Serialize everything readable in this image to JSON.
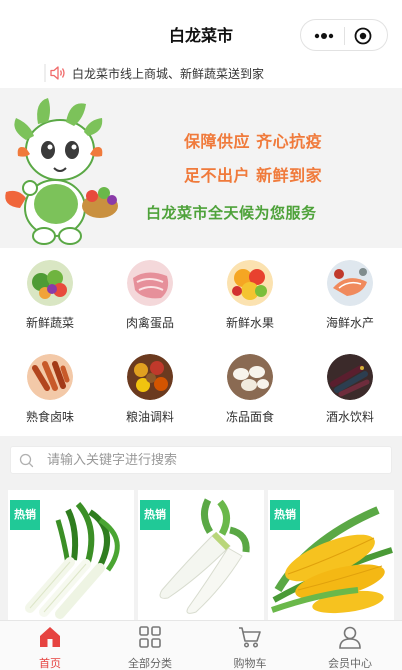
{
  "navbar": {
    "title": "白龙菜市"
  },
  "notice": {
    "text": "白龙菜市线上商城、新鲜蔬菜送到家"
  },
  "banner": {
    "line1": "保障供应 齐心抗疫",
    "line2": "足不出户 新鲜到家",
    "line3": "白龙菜市全天候为您服务",
    "colors": {
      "orange": "#f07a3b",
      "green": "#4ea23a"
    }
  },
  "categories": [
    {
      "label": "新鲜蔬菜",
      "icon": "vegetables-icon"
    },
    {
      "label": "肉禽蛋品",
      "icon": "meat-icon"
    },
    {
      "label": "新鲜水果",
      "icon": "fruit-icon"
    },
    {
      "label": "海鲜水产",
      "icon": "seafood-icon"
    },
    {
      "label": "熟食卤味",
      "icon": "cooked-food-icon"
    },
    {
      "label": "粮油调料",
      "icon": "grain-oil-icon"
    },
    {
      "label": "冻品面食",
      "icon": "frozen-food-icon"
    },
    {
      "label": "酒水饮料",
      "icon": "drinks-icon"
    }
  ],
  "search": {
    "placeholder": "请输入关键字进行搜索",
    "value": ""
  },
  "products": [
    {
      "tag": "热销",
      "image": "green-onion"
    },
    {
      "tag": "热销",
      "image": "white-radish"
    },
    {
      "tag": "热销",
      "image": "corn"
    }
  ],
  "tabbar": {
    "items": [
      {
        "label": "首页",
        "icon": "home-icon",
        "active": true
      },
      {
        "label": "全部分类",
        "icon": "grid-icon",
        "active": false
      },
      {
        "label": "购物车",
        "icon": "cart-icon",
        "active": false
      },
      {
        "label": "会员中心",
        "icon": "user-icon",
        "active": false
      }
    ],
    "active_color": "#e64340"
  }
}
